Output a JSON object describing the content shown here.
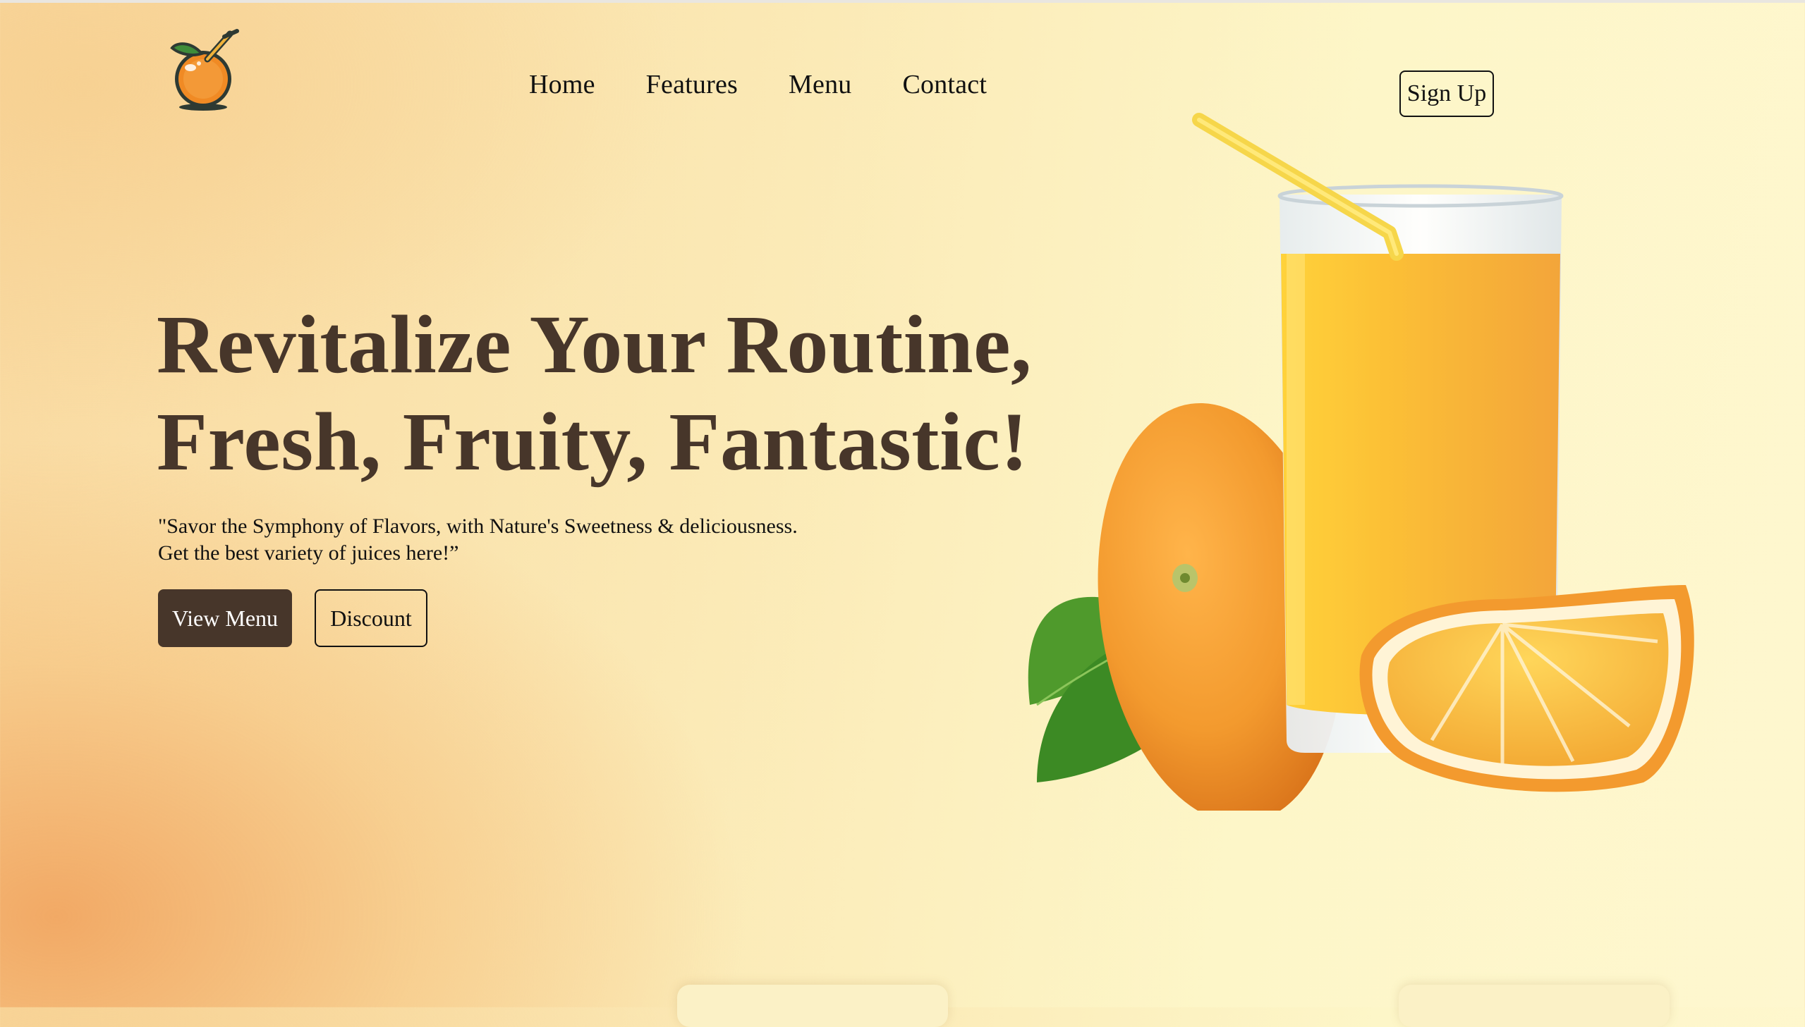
{
  "nav": {
    "logo_icon": "orange-juice-logo-icon",
    "items": [
      {
        "label": "Home"
      },
      {
        "label": "Features"
      },
      {
        "label": "Menu"
      },
      {
        "label": "Contact"
      }
    ],
    "signup_label": "Sign Up"
  },
  "hero": {
    "title_line1": "Revitalize Your Routine,",
    "title_line2": "Fresh, Fruity, Fantastic!",
    "subtitle_line1": "\"Savor the Symphony of Flavors, with Nature's Sweetness & deliciousness.",
    "subtitle_line2": "Get the best variety of juices here!”",
    "primary_button": "View Menu",
    "secondary_button": "Discount",
    "image_icon": "orange-juice-glass-image"
  },
  "colors": {
    "brand_brown": "#47362a",
    "background_cream": "#fdf6c8",
    "accent_orange": "#f0a050"
  }
}
